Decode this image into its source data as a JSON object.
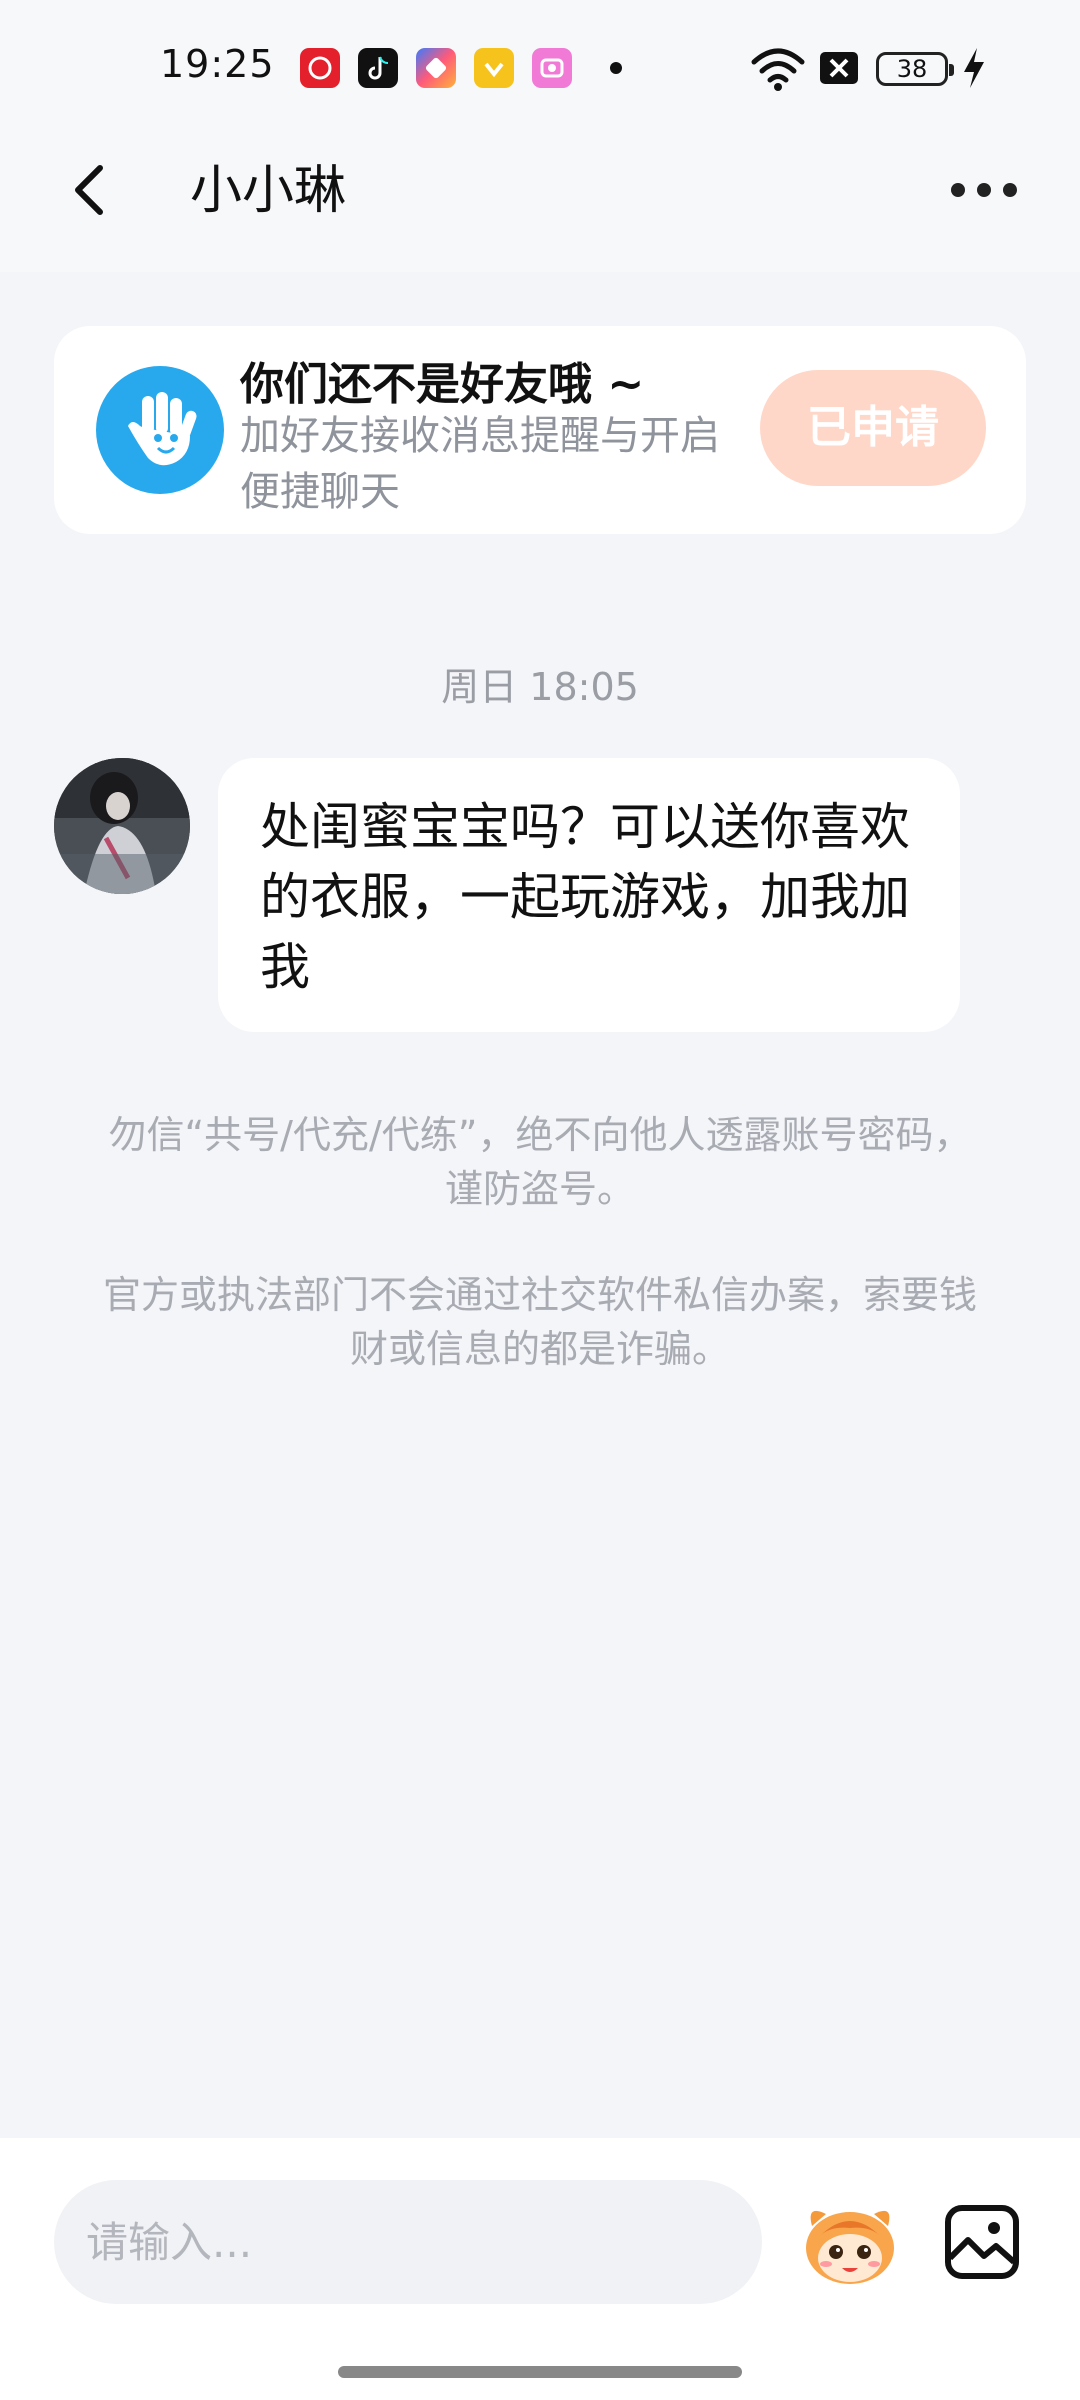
{
  "status_bar": {
    "time": "19:25",
    "battery": "38",
    "app_icons": [
      {
        "name": "taobao-icon",
        "color": "#e3202b"
      },
      {
        "name": "tiktok-icon",
        "color": "#111111"
      },
      {
        "name": "shortcut-app-icon",
        "color": "#6d5cff"
      },
      {
        "name": "coupon-app-icon",
        "color": "#f6c31d"
      },
      {
        "name": "camera-app-icon",
        "color": "#f07ad6"
      }
    ]
  },
  "nav": {
    "title": "小小琳"
  },
  "friend_card": {
    "title": "你们还不是好友哦 ~",
    "subtitle": "加好友接收消息提醒与开启便捷聊天",
    "button_label": "已申请",
    "button_color": "#ffd7c8"
  },
  "chat": {
    "timestamp": "周日 18:05",
    "message": "处闺蜜宝宝吗？可以送你喜欢的衣服，一起玩游戏，加我加我"
  },
  "notices": [
    "勿信“共号/代充/代练”，绝不向他人透露账号密码，谨防盗号。",
    "官方或执法部门不会通过社交软件私信办案，索要钱财或信息的都是诈骗。"
  ],
  "composer": {
    "placeholder": "请输入..."
  }
}
